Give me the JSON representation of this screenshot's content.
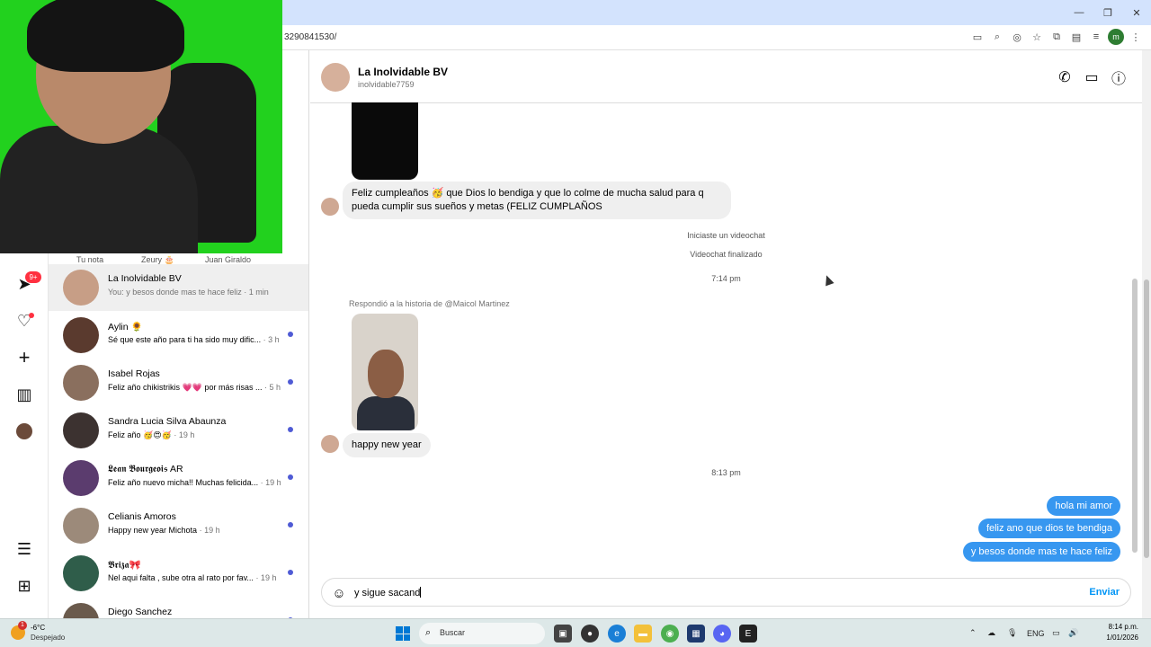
{
  "browser": {
    "url_fragment": "3290841530/",
    "profile_initial": "m"
  },
  "notes": {
    "items": [
      "Tu nota",
      "Zeury 🎂",
      "Juan Giraldo"
    ]
  },
  "left_nav": {
    "notifications_badge": "9+"
  },
  "conversations": [
    {
      "name": "La Inolvidable BV",
      "preview": "You: y besos donde mas te hace feliz · 1 min",
      "unread": false,
      "active": true
    },
    {
      "name": "Aylin 🌻",
      "preview": "Sé que este año para ti ha sido muy dific...",
      "time": "· 3 h",
      "unread": true
    },
    {
      "name": "Isabel Rojas",
      "preview": "Feliz año chikistrikis 💗💗 por más risas ...",
      "time": "· 5 h",
      "unread": true
    },
    {
      "name": "Sandra Lucia Silva Abaunza",
      "preview": "Feliz año 🥳😍🥳",
      "time": "· 19 h",
      "unread": true
    },
    {
      "name": "𝕷𝖊𝖆𝖓 𝕭𝖔𝖚𝖗𝖌𝖊𝖔𝖎𝖘 AR",
      "preview": "Feliz año nuevo micha!! Muchas felicida...",
      "time": "· 19 h",
      "unread": true
    },
    {
      "name": "Celianis Amoros",
      "preview": "Happy new year Michota",
      "time": "· 19 h",
      "unread": true
    },
    {
      "name": "𝕭𝖗𝖎𝖟𝖆🎀",
      "preview": "Nel aqui falta , sube otra al rato por fav...",
      "time": "· 19 h",
      "unread": true
    },
    {
      "name": "Diego Sanchez",
      "preview": "",
      "unread": true
    }
  ],
  "chat": {
    "contact_name": "La Inolvidable BV",
    "contact_username": "inolvidable7759",
    "birthday_message": "Feliz cumpleaños 🥳 que Dios lo bendiga y que lo colme de mucha salud para q pueda cumplir sus sueños y metas (FELIZ CUMPLAÑOS",
    "system_1": "Iniciaste un videochat",
    "system_2": "Videochat finalizado",
    "time_1": "7:14 pm",
    "reply_label": "Respondió a la historia de @Maicol Martinez",
    "reply_message": "happy new year",
    "time_2": "8:13 pm",
    "outgoing": [
      "hola mi amor",
      "feliz ano que dios te bendiga",
      "y besos donde mas te hace feliz"
    ],
    "composer_value": "y sigue sacand",
    "send_label": "Enviar"
  },
  "taskbar": {
    "weather_temp": "-6°C",
    "weather_cond": "Despejado",
    "weather_badge": "1",
    "search_label": "Buscar",
    "lang": "ENG",
    "time": "8:14 p.m.",
    "date": "1/01/2026"
  },
  "colors": {
    "accent_blue": "#3797f0",
    "unread_dot": "#4f5bd5",
    "badge_red": "#ff3040"
  }
}
